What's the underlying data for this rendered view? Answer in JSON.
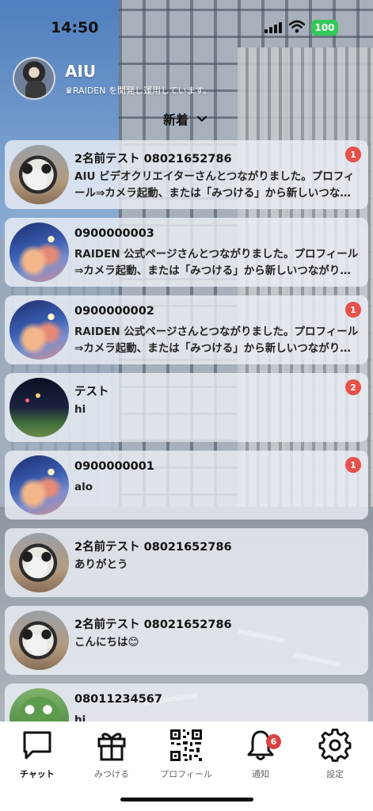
{
  "status_bar": {
    "time": "14:50",
    "battery": "100"
  },
  "profile": {
    "name": "AIU",
    "description": "♛RAIDEN を開発し運用しています。"
  },
  "sort": {
    "label": "新着"
  },
  "chats": [
    {
      "name": "2名前テスト 08021652786",
      "preview": "AIU ビデオクリエイターさんとつながりました。プロフィール⇒カメラ起動、または「みつける」から新しいつながりを探しましょう。",
      "unread": "1",
      "avatar": "cat"
    },
    {
      "name": "0900000003",
      "preview": "RAIDEN 公式ページさんとつながりました。プロフィール⇒カメラ起動、または「みつける」から新しいつながりを探しましょう。",
      "unread": "",
      "avatar": "sky"
    },
    {
      "name": "0900000002",
      "preview": "RAIDEN 公式ページさんとつながりました。プロフィール⇒カメラ起動、または「みつける」から新しいつながりを探しましょう。",
      "unread": "1",
      "avatar": "sky"
    },
    {
      "name": "テスト",
      "preview": "hi",
      "unread": "2",
      "avatar": "night"
    },
    {
      "name": "0900000001",
      "preview": "alo",
      "unread": "1",
      "avatar": "sky"
    },
    {
      "name": "2名前テスト 08021652786",
      "preview": "ありがとう",
      "unread": "",
      "avatar": "cat"
    },
    {
      "name": "2名前テスト 08021652786",
      "preview": "こんにちは😊",
      "unread": "",
      "avatar": "cat"
    },
    {
      "name": "08011234567",
      "preview": "hi",
      "unread": "",
      "avatar": "frog"
    }
  ],
  "tabs": [
    {
      "label": "チャット",
      "icon": "chat-bubble-icon",
      "active": true
    },
    {
      "label": "みつける",
      "icon": "gift-icon",
      "active": false
    },
    {
      "label": "プロフィール",
      "icon": "qr-code-icon",
      "active": false
    },
    {
      "label": "通知",
      "icon": "bell-icon",
      "active": false,
      "badge": "6"
    },
    {
      "label": "設定",
      "icon": "gear-icon",
      "active": false
    }
  ],
  "colors": {
    "badge": "#e8504a",
    "battery": "#34c759",
    "card": "#ecf0f6"
  }
}
